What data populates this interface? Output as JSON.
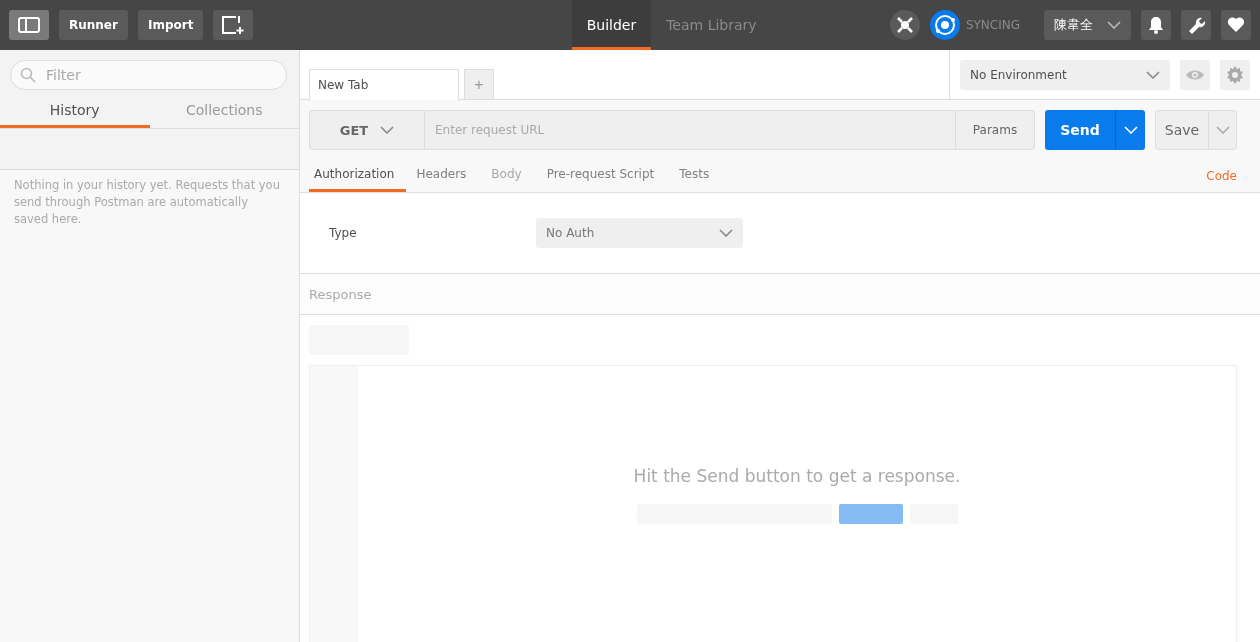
{
  "toolbar": {
    "sidebar_toggle": {
      "on": true
    },
    "buttons": [
      "Runner",
      "Import"
    ],
    "header_tabs": [
      {
        "label": "Builder",
        "selected": true
      },
      {
        "label": "Team Library",
        "selected": false
      }
    ],
    "sync_status": "SYNCING",
    "user": "陳韋全"
  },
  "sidebar": {
    "filter": {
      "placeholder": "Filter"
    },
    "tabs": [
      {
        "label": "History",
        "selected": true
      },
      {
        "label": "Collections",
        "selected": false
      }
    ],
    "empty_message": "Nothing in your history yet. Requests that you send through Postman are automatically saved here."
  },
  "request_tabs": [
    {
      "label": "New Tab",
      "selected": true
    }
  ],
  "add_tab": "+",
  "environment": "No Environment",
  "request": {
    "method": "GET",
    "url": {
      "placeholder": "Enter request URL"
    },
    "params": "Params",
    "send": "Send",
    "save": "Save"
  },
  "request_sections": [
    {
      "label": "Authorization",
      "selected": true,
      "disabled": false
    },
    {
      "label": "Headers",
      "selected": false,
      "disabled": false
    },
    {
      "label": "Body",
      "selected": false,
      "disabled": true
    },
    {
      "label": "Pre-request Script",
      "selected": false,
      "disabled": false
    },
    {
      "label": "Tests",
      "selected": false,
      "disabled": false
    }
  ],
  "code_link": "Code",
  "auth": {
    "type_label": "Type",
    "type_value": "No Auth"
  },
  "response": {
    "title": "Response",
    "empty_message": "Hit the Send button to get a response."
  }
}
